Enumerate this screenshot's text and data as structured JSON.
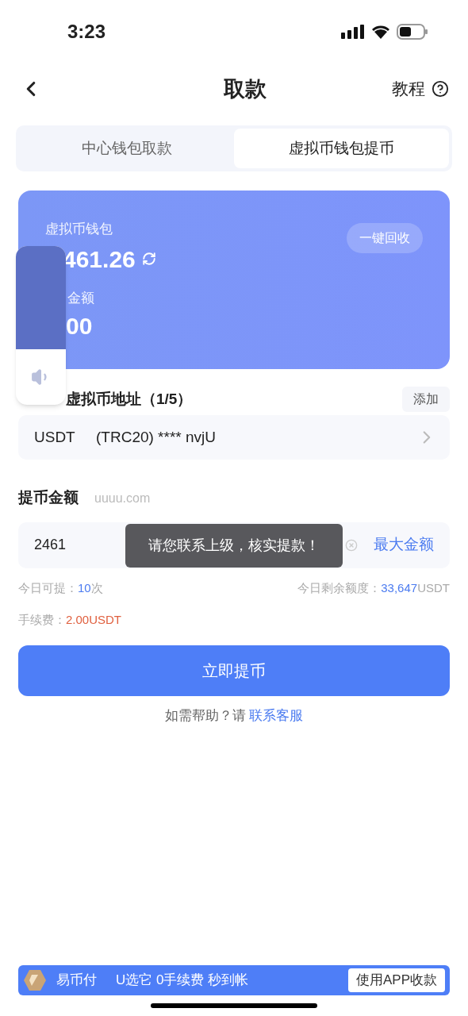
{
  "status_bar": {
    "time": "3:23"
  },
  "header": {
    "title": "取款",
    "help": "教程"
  },
  "tabs": [
    {
      "label": "中心钱包取款",
      "selected": false
    },
    {
      "label": "虚拟币钱包提币",
      "selected": true
    }
  ],
  "wallet_card": {
    "label": "虚拟币钱包",
    "balance": "461.26",
    "locked_label": "金额",
    "locked": "00",
    "recall_button": "一键回收"
  },
  "address_section": {
    "title": "虚拟币地址（1/5）",
    "add_button": "添加",
    "network": "USDT",
    "address": "(TRC20) **** nvjU"
  },
  "amount_section": {
    "label": "提币金额",
    "hint": "uuuu.com",
    "value": "2461",
    "max_button": "最大金额"
  },
  "toast": "请您联系上级，核实提款！",
  "limits": {
    "count_label": "今日可提：",
    "count": "10",
    "count_unit": "次",
    "remaining_label": "今日剩余额度：",
    "remaining": "33,647",
    "remaining_unit": "USDT",
    "fee_label": "手续费：",
    "fee": "2.00USDT"
  },
  "submit_button": "立即提币",
  "help": {
    "text": "如需帮助？请",
    "link": "联系客服"
  },
  "banner": {
    "brand": "易币付",
    "slogan": "U选它 0手续费 秒到帐",
    "button": "使用APP收款"
  }
}
